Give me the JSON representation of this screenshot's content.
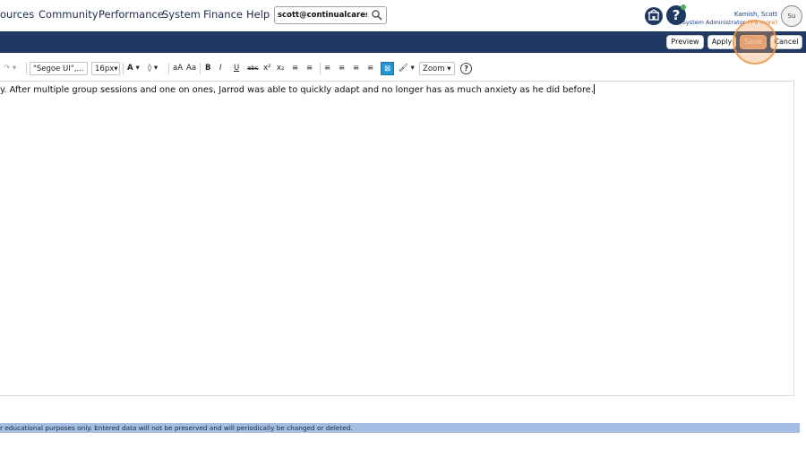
{
  "nav": {
    "items": [
      "ources",
      "Community",
      "Performance",
      "System",
      "Finance",
      "Help"
    ],
    "search_value": "scott@continualcaresc"
  },
  "user": {
    "name": "Kamish, Scott",
    "role": "System Administrator",
    "role_more": "(+6 more)",
    "avatar_alt": "Su"
  },
  "help_label": "?",
  "actions": {
    "preview": "Preview",
    "apply": "Apply",
    "save": "Save",
    "cancel": "Cancel"
  },
  "toolbar": {
    "redo": "↷ ▾",
    "font_family": "\"Segoe UI\",...",
    "font_size": "16px",
    "font_color": "A",
    "highlight": "◊",
    "lower": "aA",
    "upper": "Aa",
    "bold": "B",
    "italic": "I",
    "underline": "U",
    "strike": "abc",
    "superscript": "x²",
    "subscript": "x₂",
    "ordered": "≡",
    "unordered": "≡",
    "align_left": "≡",
    "align_center": "≡",
    "align_right": "≡",
    "justify": "≡",
    "clear": "⊠",
    "paint": "🖌",
    "zoom": "Zoom",
    "help": "?"
  },
  "editor": {
    "text": "y. After multiple group sessions and one on ones, Jarrod was able to quickly adapt and no longer has as much anxiety as he did before."
  },
  "banner": {
    "text": "r educational purposes only. Entered data will not be preserved and will periodically be changed or deleted."
  },
  "colors": {
    "header_bar": "#1e3a62",
    "banner": "#a4bde2",
    "save_highlight": "#f4a460",
    "selected_tool": "#2196d3"
  }
}
